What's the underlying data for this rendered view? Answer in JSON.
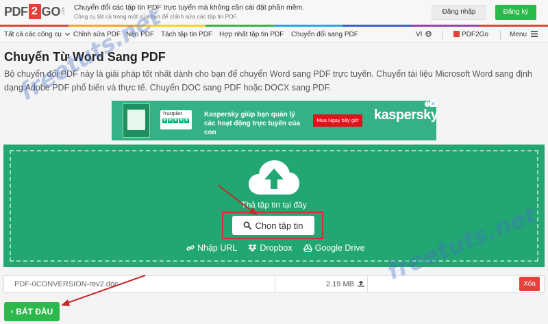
{
  "header": {
    "logo": {
      "pdf": "PDF",
      "two": "2",
      "go": "GO",
      "com": ".com"
    },
    "tagline_main": "Chuyển đổi các tập tin PDF trực tuyến mà không cần cài đặt phần mềm.",
    "tagline_sub": "Công cụ tất cả trong một của bạn để chỉnh sửa các tập tin PDF.",
    "login_label": "Đăng nhập",
    "register_label": "Đăng ký"
  },
  "nav": {
    "items": [
      "Tất cả các công cụ",
      "Chỉnh sửa PDF",
      "Nén PDF",
      "Tách tập tin PDF",
      "Hợp nhất tập tin PDF",
      "Chuyển đổi sang PDF"
    ],
    "language": "VI",
    "brand": "PDF2Go",
    "menu": "Menu"
  },
  "page": {
    "title": "Chuyển Từ Word Sang PDF",
    "description": "Bộ chuyển đổi PDF này là giải pháp tốt nhất dành cho bạn để chuyển Word sang PDF trực tuyến. Chuyển tài liệu Microsoft Word sang định dạng Adobe PDF phổ biến và thực tế. Chuyển DOC sang PDF hoặc DOCX sang PDF."
  },
  "ad": {
    "trustpilot": "Trustpilot",
    "text": "Kaspersky giúp bạn quản lý các hoạt động trực tuyến của con",
    "button": "Mua Ngay bây giờ",
    "brand": "kaspersky"
  },
  "upload": {
    "drop_label": "Thả tập tin tại đây",
    "choose_label": "Chọn tập tin",
    "sources": [
      "Nhập URL",
      "Dropbox",
      "Google Drive"
    ]
  },
  "file": {
    "name": "PDF-0CONVERSION-rev2.doc",
    "size": "2.19 MB",
    "remove_label": "Xóa"
  },
  "start_label": "BẮT ĐẦU",
  "watermark": "freetuts.net",
  "colors": {
    "accent_green": "#22a772",
    "button_green": "#2db84b",
    "danger_red": "#e3413a",
    "highlight_red": "#d32f2f"
  }
}
